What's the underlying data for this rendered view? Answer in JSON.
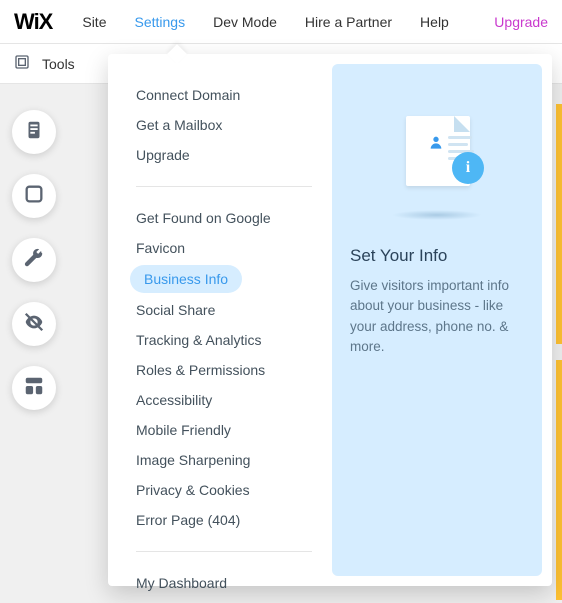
{
  "logo_text": "WiX",
  "topnav": {
    "site": "Site",
    "settings": "Settings",
    "devmode": "Dev Mode",
    "hire": "Hire a Partner",
    "help": "Help",
    "upgrade": "Upgrade"
  },
  "subbar": {
    "tools": "Tools"
  },
  "settings_menu": {
    "group1": {
      "connect_domain": "Connect Domain",
      "get_mailbox": "Get a Mailbox",
      "upgrade": "Upgrade"
    },
    "group2": {
      "get_found": "Get Found on Google",
      "favicon": "Favicon",
      "business_info": "Business Info",
      "social_share": "Social Share",
      "tracking": "Tracking & Analytics",
      "roles": "Roles & Permissions",
      "accessibility": "Accessibility",
      "mobile_friendly": "Mobile Friendly",
      "image_sharpening": "Image Sharpening",
      "privacy": "Privacy & Cookies",
      "error_page": "Error Page (404)"
    },
    "group3": {
      "my_dashboard": "My Dashboard"
    }
  },
  "preview": {
    "title": "Set Your Info",
    "description": "Give visitors important info about your business - like your address, phone no. & more.",
    "info_badge": "i"
  }
}
